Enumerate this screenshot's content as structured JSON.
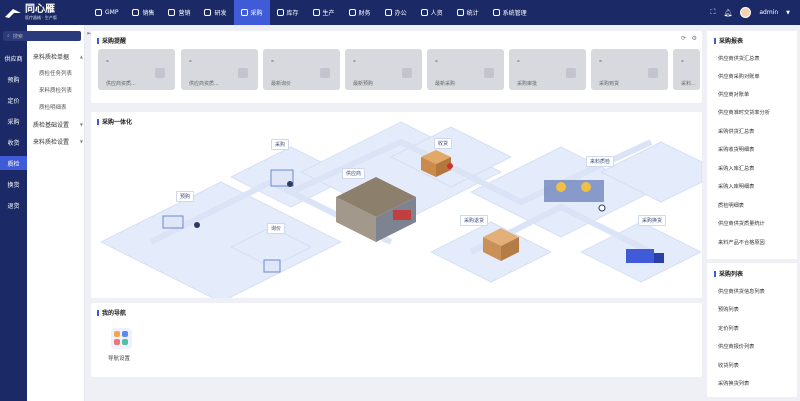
{
  "app": {
    "name": "同心雁",
    "subtitle": "医疗器械 · 生产版"
  },
  "topnav": [
    {
      "label": "GMP",
      "icon": "gmp-icon"
    },
    {
      "label": "销售",
      "icon": "sales-icon"
    },
    {
      "label": "营销",
      "icon": "marketing-icon"
    },
    {
      "label": "研发",
      "icon": "rnd-icon"
    },
    {
      "label": "采购",
      "icon": "purchase-icon",
      "active": true
    },
    {
      "label": "库存",
      "icon": "inventory-icon"
    },
    {
      "label": "生产",
      "icon": "production-icon"
    },
    {
      "label": "财务",
      "icon": "finance-icon"
    },
    {
      "label": "办公",
      "icon": "office-icon"
    },
    {
      "label": "人资",
      "icon": "hr-icon"
    },
    {
      "label": "统计",
      "icon": "stats-icon"
    },
    {
      "label": "系统管理",
      "icon": "settings-icon"
    }
  ],
  "user": {
    "name": "admin"
  },
  "search": {
    "placeholder": "搜索"
  },
  "sidebar_primary": [
    {
      "label": "供应商"
    },
    {
      "label": "预购"
    },
    {
      "label": "定价"
    },
    {
      "label": "采购"
    },
    {
      "label": "收货"
    },
    {
      "label": "质检",
      "active": true
    },
    {
      "label": "换货"
    },
    {
      "label": "退货"
    }
  ],
  "sidebar_secondary": {
    "group1": "来料质检单据",
    "items": [
      "质检任务列表",
      "来料质检列表",
      "质检明细表"
    ],
    "group2": "质检基础设置",
    "group3": "来料质检设置"
  },
  "reminder": {
    "title": "采购提醒",
    "cards": [
      {
        "value": "-",
        "label": "供应商资质..."
      },
      {
        "value": "-",
        "label": "供应商资质..."
      },
      {
        "value": "-",
        "label": "最新询价"
      },
      {
        "value": "-",
        "label": "最新预购"
      },
      {
        "value": "-",
        "label": "最新采购"
      },
      {
        "value": "-",
        "label": "采购审批"
      },
      {
        "value": "-",
        "label": "采购到货"
      },
      {
        "value": "-",
        "label": "采料..."
      }
    ]
  },
  "integration": {
    "title": "采购一体化",
    "labels": [
      "采购",
      "收货",
      "来料质检",
      "供应商",
      "预购",
      "询价",
      "采购退货",
      "采购换货"
    ]
  },
  "navigation": {
    "title": "我的导航",
    "items": [
      {
        "label": "导航设置"
      }
    ]
  },
  "reports": {
    "title": "采购报表",
    "items": [
      "供应商供货汇总表",
      "供应商采购对账单",
      "供应商对账单",
      "供应商准时交货率分析",
      "采购供货汇总表",
      "采购收货明细表",
      "采购入库汇总表",
      "采购入库明细表",
      "质检明细表",
      "供应商供货质量统计",
      "来料产品不合格原因"
    ]
  },
  "lists": {
    "title": "采购列表",
    "items": [
      "供应商供货信息列表",
      "预购列表",
      "定价列表",
      "供应商报价列表",
      "收货列表",
      "采购换货列表"
    ]
  }
}
